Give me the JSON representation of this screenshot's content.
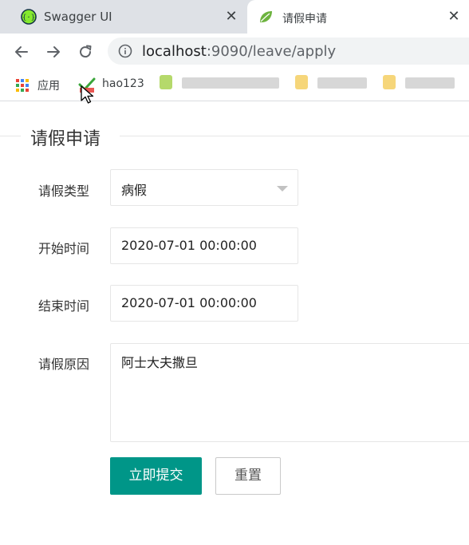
{
  "tabs": [
    {
      "title": "Swagger UI",
      "icon": "swagger-icon",
      "close": "✕"
    },
    {
      "title": "请假申请",
      "icon": "spring-leaf-icon",
      "close": "✕"
    }
  ],
  "toolbar": {
    "url_host": "localhost",
    "url_path": ":9090/leave/apply"
  },
  "bookmarks": {
    "apps_label": "应用",
    "hao123_label": "hao123"
  },
  "form": {
    "legend": "请假申请",
    "type_label": "请假类型",
    "type_value": "病假",
    "start_label": "开始时间",
    "start_value": "2020-07-01 00:00:00",
    "end_label": "结束时间",
    "end_value": "2020-07-01 00:00:00",
    "reason_label": "请假原因",
    "reason_value": "阿士大夫撒旦",
    "submit_label": "立即提交",
    "reset_label": "重置"
  },
  "colors": {
    "primary": "#009688",
    "tabstrip": "#dee1e6",
    "omnibox": "#f1f3f4"
  }
}
